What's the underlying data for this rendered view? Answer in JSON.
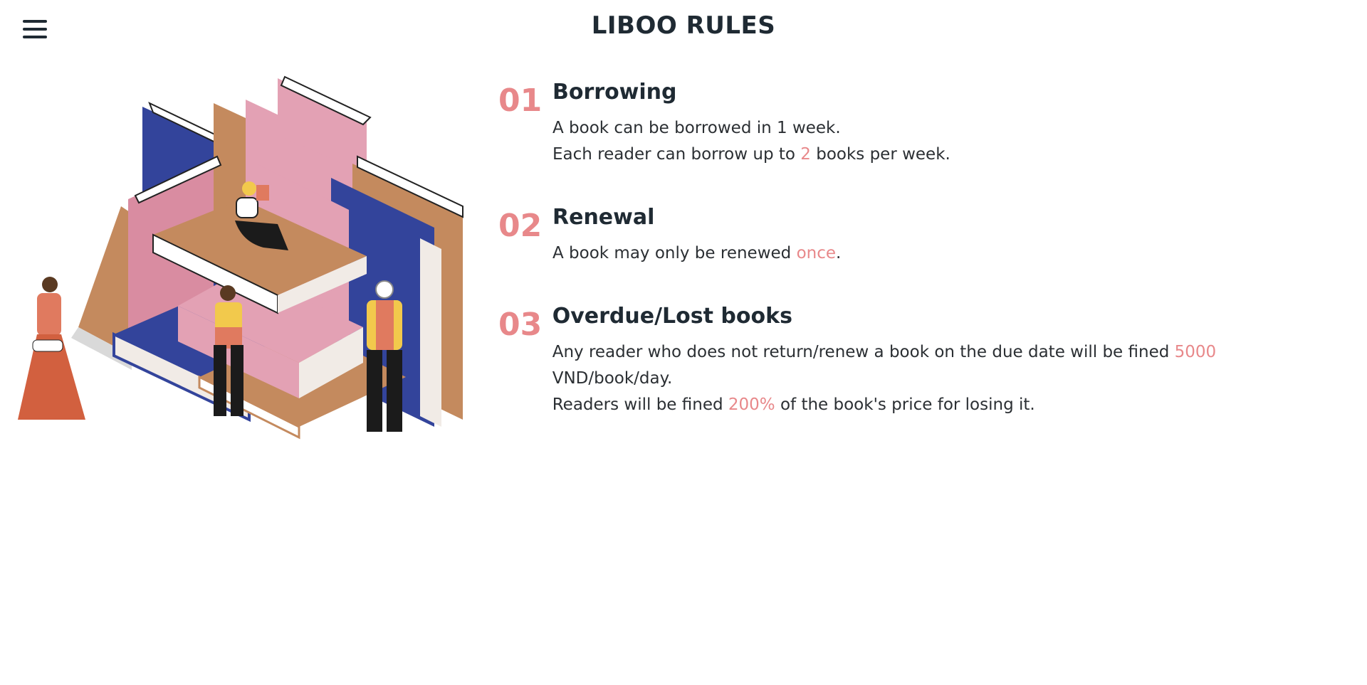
{
  "header": {
    "title": "LIBOO RULES"
  },
  "colors": {
    "accent": "#e8888a",
    "text": "#2b2f33"
  },
  "illustration": {
    "name": "people-reading-on-stacked-books"
  },
  "rules": [
    {
      "number": "01",
      "title": "Borrowing",
      "line1": "A book can be borrowed in 1 week.",
      "line2_before": "Each reader can borrow up to ",
      "line2_value": "2",
      "line2_after": " books per week."
    },
    {
      "number": "02",
      "title": "Renewal",
      "line1_before": "A book may only be renewed ",
      "line1_value": "once",
      "line1_after": "."
    },
    {
      "number": "03",
      "title": "Overdue/Lost books",
      "line1_before": "Any reader who does not return/renew a book on the due date will be fined ",
      "line1_value": "5000",
      "line1_after": " VND/book/day.",
      "line2_before": "Readers will be fined ",
      "line2_value": "200%",
      "line2_after": " of the book's price for losing it."
    }
  ]
}
